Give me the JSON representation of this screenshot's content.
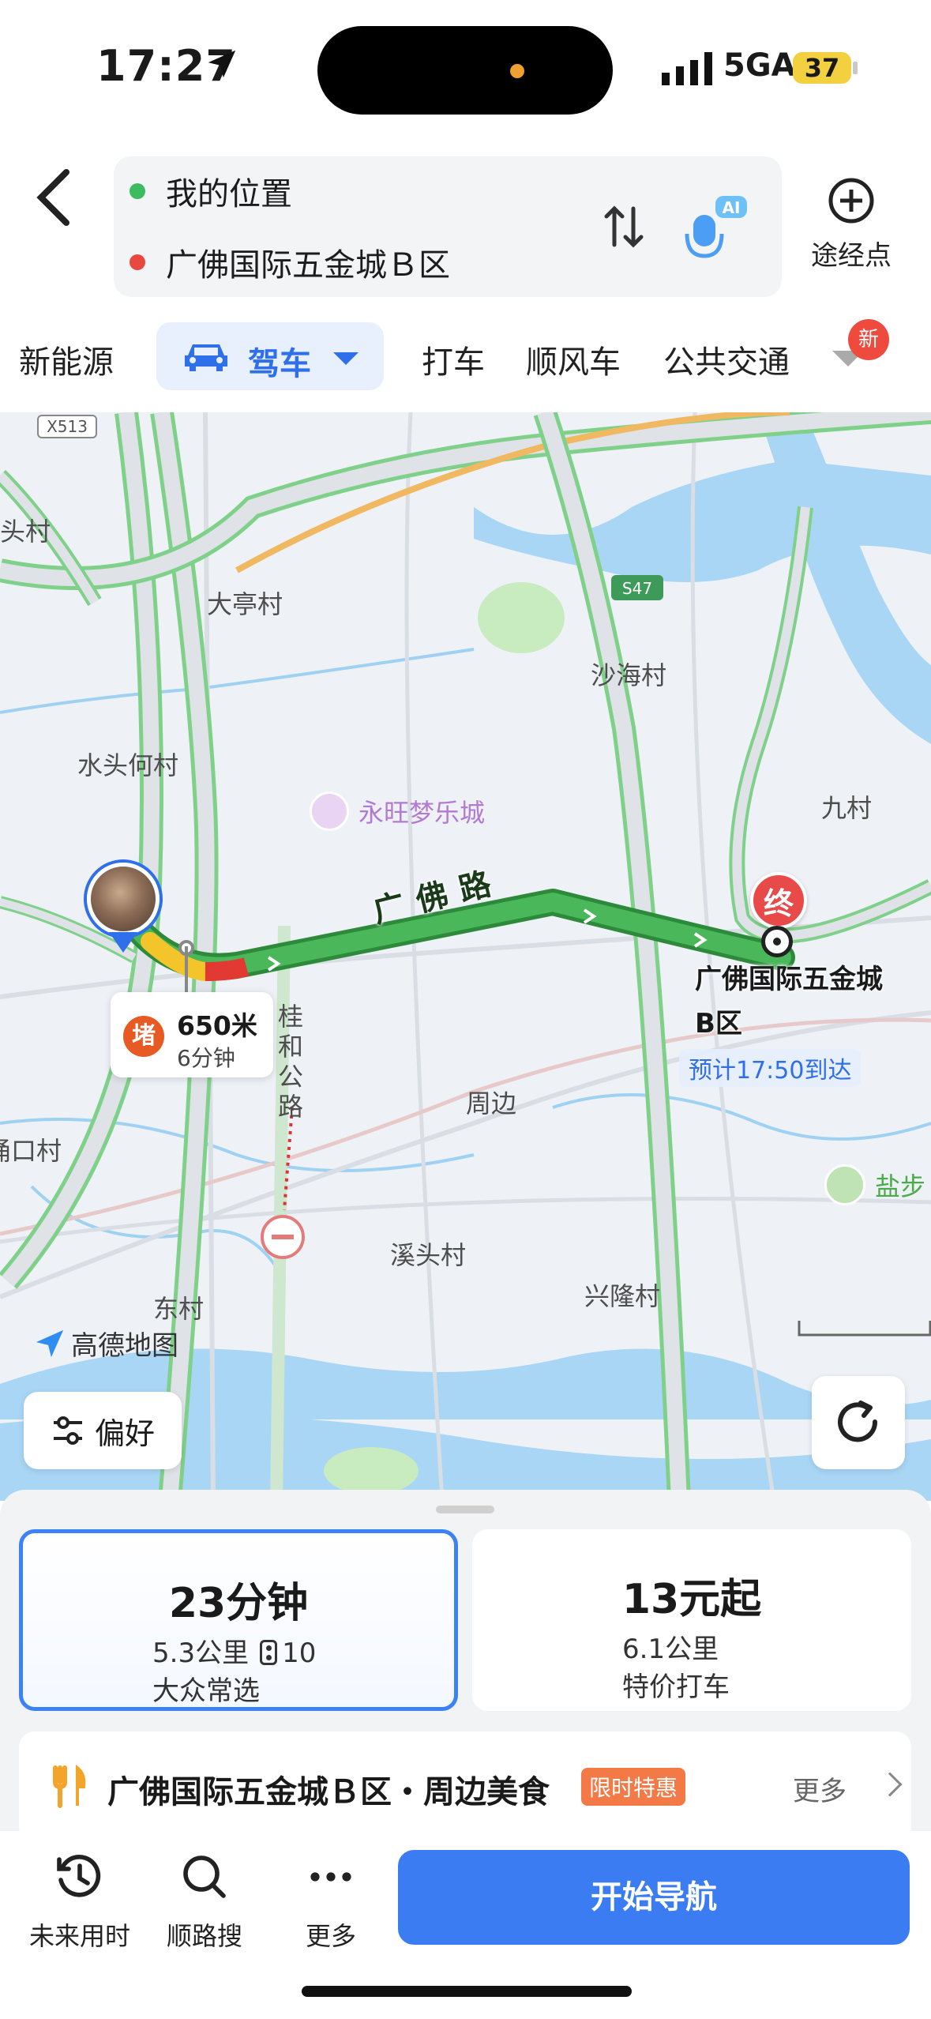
{
  "status_bar": {
    "time": "17:27",
    "network": "5GA",
    "battery": "37"
  },
  "route": {
    "origin": "我的位置",
    "destination": "广佛国际五金城Ｂ区",
    "origin_color": "#3dbb61",
    "destination_color": "#e8483f",
    "ai_label": "AI",
    "waypoint_label": "途经点"
  },
  "tabs": {
    "items": [
      "新能源",
      "驾车",
      "打车",
      "顺风车",
      "公共交通"
    ],
    "active": "驾车",
    "new_badge": "新"
  },
  "map": {
    "labels": {
      "x513": "X513",
      "s47": "S47",
      "toucun": "头村",
      "datingcun": "大亭村",
      "shahaicun": "沙海村",
      "shuitouhecun": "水头何村",
      "yongwang": "永旺梦乐城",
      "jiucun": "九村",
      "guifo": "桂和公路",
      "zhoubian": "周边",
      "kocun": "涌口村",
      "xitoucun": "溪头村",
      "xinglongcun": "兴隆村",
      "dongcun": "东村",
      "yanbu": "盐步"
    },
    "road_name": "广佛路",
    "jam": {
      "badge": "堵",
      "distance": "650米",
      "time": "6分钟"
    },
    "end_badge": "终",
    "destination_label": "广佛国际五金城B区",
    "eta": "预计17:50到达",
    "brand": "高德地图",
    "preference_button": "偏好"
  },
  "options": [
    {
      "time": "23分钟",
      "distance": "5.3公里",
      "lights": "10",
      "tag": "大众常选",
      "selected": true
    },
    {
      "price": "13元起",
      "distance": "6.1公里",
      "tag": "特价打车",
      "selected": false
    }
  ],
  "food": {
    "title": "广佛国际五金城Ｂ区・周边美食",
    "promo": "限时特惠",
    "more": "更多"
  },
  "bottom_bar": {
    "future_time": "未来用时",
    "along_search": "顺路搜",
    "more": "更多",
    "start_nav": "开始导航"
  },
  "colors": {
    "accent": "#3b7cf2",
    "route_green": "#3fae4f",
    "jam_red": "#e23a33",
    "slow_yellow": "#f4c52b"
  }
}
